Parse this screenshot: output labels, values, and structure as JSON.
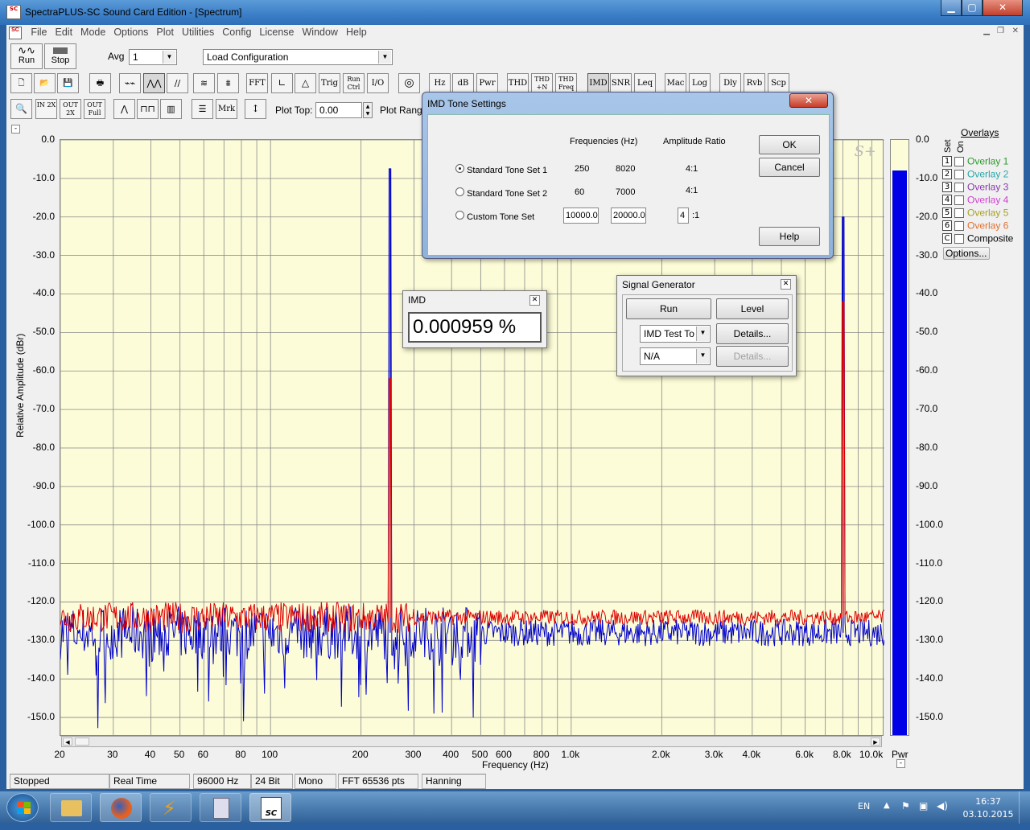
{
  "window": {
    "title": "SpectraPLUS-SC Sound Card Edition - [Spectrum]",
    "icon_text": "SC"
  },
  "menu": [
    "File",
    "Edit",
    "Mode",
    "Options",
    "Plot",
    "Utilities",
    "Config",
    "License",
    "Window",
    "Help"
  ],
  "toolbar1": {
    "run": "Run",
    "stop": "Stop",
    "avg_label": "Avg",
    "avg_value": "1",
    "config_value": "Load Configuration"
  },
  "toolbar2": [
    "FFT",
    "Trig",
    "Run Ctrl",
    "I/O",
    "Hz",
    "dB",
    "Pwr",
    "THD",
    "THD +N",
    "THD Freq",
    "IMD",
    "SNR",
    "Leq",
    "Mac",
    "Log",
    "Dly",
    "Rvb",
    "Scp"
  ],
  "toolbar3": {
    "zoom_in": "IN 2X",
    "zoom_out": "OUT 2X",
    "zoom_full": "OUT Full",
    "mrk": "Mrk",
    "plot_top_label": "Plot Top:",
    "plot_top_value": "0.00",
    "plot_range_label": "Plot Rang"
  },
  "plot": {
    "ylabel": "Relative Amplitude (dBr)",
    "xlabel": "Frequency (Hz)",
    "pwr_label": "Pwr",
    "yticks": [
      "0.0",
      "-10.0",
      "-20.0",
      "-30.0",
      "-40.0",
      "-50.0",
      "-60.0",
      "-70.0",
      "-80.0",
      "-90.0",
      "-100.0",
      "-110.0",
      "-120.0",
      "-130.0",
      "-140.0",
      "-150.0"
    ],
    "xticks": [
      "20",
      "30",
      "40",
      "50",
      "60",
      "80",
      "100",
      "200",
      "300",
      "400",
      "500",
      "600",
      "800",
      "1.0k",
      "2.0k",
      "3.0k",
      "4.0k",
      "6.0k",
      "8.0k",
      "10.0k"
    ],
    "watermark": "S+"
  },
  "chart_data": {
    "type": "line",
    "xlabel": "Frequency (Hz)",
    "ylabel": "Relative Amplitude (dBr)",
    "xscale": "log",
    "xlim": [
      20,
      11000
    ],
    "ylim": [
      -155,
      0
    ],
    "series": [
      {
        "color": "#0000cc",
        "peaks": [
          [
            250,
            -7.5
          ],
          [
            8020,
            -20.0
          ]
        ],
        "noise_floor": -128
      },
      {
        "color": "#dd0000",
        "peaks": [
          [
            250,
            -62
          ],
          [
            8020,
            -42
          ]
        ],
        "noise_floor": -124
      }
    ],
    "pwr_bar_level_dbr": -7.5
  },
  "overlays": {
    "title": "Overlays",
    "set_label": "Set",
    "on_label": "On",
    "items": [
      {
        "num": "1",
        "label": "Overlay 1",
        "color": "#2c9a2c"
      },
      {
        "num": "2",
        "label": "Overlay 2",
        "color": "#28a8a8"
      },
      {
        "num": "3",
        "label": "Overlay 3",
        "color": "#8b3ab0"
      },
      {
        "num": "4",
        "label": "Overlay 4",
        "color": "#d040d0"
      },
      {
        "num": "5",
        "label": "Overlay 5",
        "color": "#a8a028"
      },
      {
        "num": "6",
        "label": "Overlay 6",
        "color": "#e07030"
      },
      {
        "num": "C",
        "label": "Composite",
        "color": "#000000"
      }
    ],
    "options_btn": "Options..."
  },
  "imd_dialog": {
    "title": "IMD Tone Settings",
    "freq_header": "Frequencies (Hz)",
    "ratio_header": "Amplitude Ratio",
    "rows": [
      {
        "label": "Standard Tone Set 1",
        "f1": "250",
        "f2": "8020",
        "ratio": "4:1"
      },
      {
        "label": "Standard Tone Set 2",
        "f1": "60",
        "f2": "7000",
        "ratio": "4:1"
      }
    ],
    "custom_label": "Custom Tone Set",
    "custom_f1": "10000.0",
    "custom_f2": "20000.0",
    "custom_ratio": "4",
    "custom_ratio_suffix": ":1",
    "ok": "OK",
    "cancel": "Cancel",
    "help": "Help"
  },
  "imd_readout": {
    "title": "IMD",
    "value": "0.000959 %"
  },
  "siggen": {
    "title": "Signal Generator",
    "run": "Run",
    "level": "Level",
    "mode": "IMD Test To",
    "details": "Details...",
    "mode2": "N/A",
    "details2": "Details..."
  },
  "status": [
    "Stopped",
    "Real Time",
    "96000 Hz",
    "24 Bit",
    "Mono",
    "FFT 65536 pts",
    "Hanning"
  ],
  "taskbar": {
    "lang": "EN",
    "time": "16:37",
    "date": "03.10.2015"
  }
}
